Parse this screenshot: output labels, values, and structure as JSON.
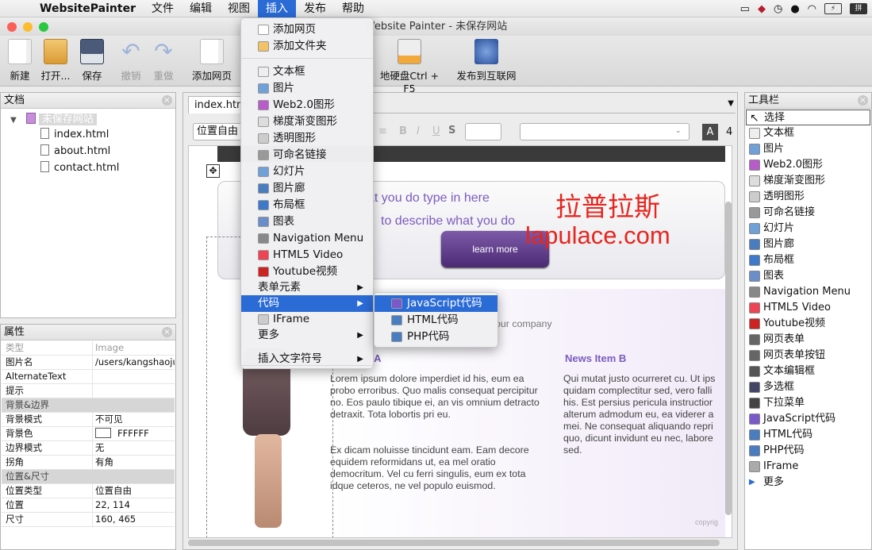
{
  "menubar": {
    "app": "WebsitePainter",
    "items": [
      "文件",
      "编辑",
      "视图",
      "插入",
      "发布",
      "帮助"
    ],
    "active_index": 3
  },
  "window": {
    "title": "Website Painter - 未保存网站"
  },
  "toolbar": {
    "new": "新建",
    "open": "打开...",
    "save": "保存",
    "undo": "撤销",
    "redo": "重做",
    "add_page": "添加网页",
    "export_disk": "地硬盘Ctrl + F5",
    "publish": "发布到互联网"
  },
  "docs_panel": {
    "title": "文档",
    "site": "未保存网站",
    "files": [
      "index.html",
      "about.html",
      "contact.html"
    ]
  },
  "props_panel": {
    "title": "属性",
    "rows": [
      {
        "k": "类型",
        "v": "Image"
      },
      {
        "k": "图片名",
        "v": "/users/kangshaojun"
      },
      {
        "k": "AlternateText",
        "v": ""
      },
      {
        "k": "提示",
        "v": ""
      },
      {
        "section": "背景&边界"
      },
      {
        "k": "背景模式",
        "v": "不可见"
      },
      {
        "k": "背景色",
        "v": "FFFFFF"
      },
      {
        "k": "边界模式",
        "v": "无"
      },
      {
        "k": "拐角",
        "v": "有角"
      },
      {
        "section": "位置&尺寸"
      },
      {
        "k": "位置类型",
        "v": "位置自由"
      },
      {
        "k": "位置",
        "v": "22, 114"
      },
      {
        "k": "尺寸",
        "v": "160, 465"
      }
    ]
  },
  "editor": {
    "tab": "index.html",
    "position_select": "位置自由",
    "font_size_end": "4",
    "hero_line1": "at you do type in here",
    "hero_line2": "to describe what you do",
    "learn_more": "learn more",
    "company_fragment": "our company",
    "news_a_title": "n A",
    "news_b_title": "News Item B",
    "col_a_p1": "Lorem ipsum dolore imperdiet id his, eum ea probo erroribus. Quo malis consequat percipitur no. Eos paulo tibique ei, an vis omnium detracto detraxit. Tota lobortis pri eu.",
    "col_a_p2": "Ex dicam noluisse tincidunt eam. Eam decore equidem reformidans ut, ea mel oratio democritum. Vel cu ferri singulis, eum ex tota idque ceteros, ne vel populo euismod.",
    "col_b_p1": "Qui mutat justo ocurreret cu. Ut ips quidam complectitur sed, vero falli his. Est persius pericula instructior alterum admodum eu, ea viderer a mei. Ne consequat aliquando repri quo, dicunt invidunt eu nec, labore sed.",
    "copyright": "copyrig"
  },
  "watermark": {
    "cn": "拉普拉斯",
    "url": "lapulace.com",
    "color": "#e8251e"
  },
  "insert_menu": {
    "items": [
      "添加网页",
      "添加文件夹",
      "文本框",
      "图片",
      "Web2.0图形",
      "梯度渐变图形",
      "透明图形",
      "可命名链接",
      "幻灯片",
      "图片廊",
      "布局框",
      "图表",
      "Navigation Menu",
      "HTML5 Video",
      "Youtube视频",
      "表单元素",
      "代码",
      "IFrame",
      "更多",
      "插入文字符号"
    ],
    "highlight": "代码"
  },
  "code_submenu": {
    "items": [
      "JavaScript代码",
      "HTML代码",
      "PHP代码"
    ],
    "highlight": "JavaScript代码"
  },
  "toolbox": {
    "title": "工具栏",
    "items": [
      "选择",
      "文本框",
      "图片",
      "Web2.0图形",
      "梯度渐变图形",
      "透明图形",
      "可命名链接",
      "幻灯片",
      "图片廊",
      "布局框",
      "图表",
      "Navigation Menu",
      "HTML5 Video",
      "Youtube视频",
      "网页表单",
      "网页表单按钮",
      "文本编辑框",
      "多选框",
      "下拉菜单",
      "JavaScript代码",
      "HTML代码",
      "PHP代码",
      "IFrame",
      "更多"
    ]
  },
  "colors": {
    "accent": "#2a6bd6",
    "brand_purple": "#5b3a8c"
  }
}
